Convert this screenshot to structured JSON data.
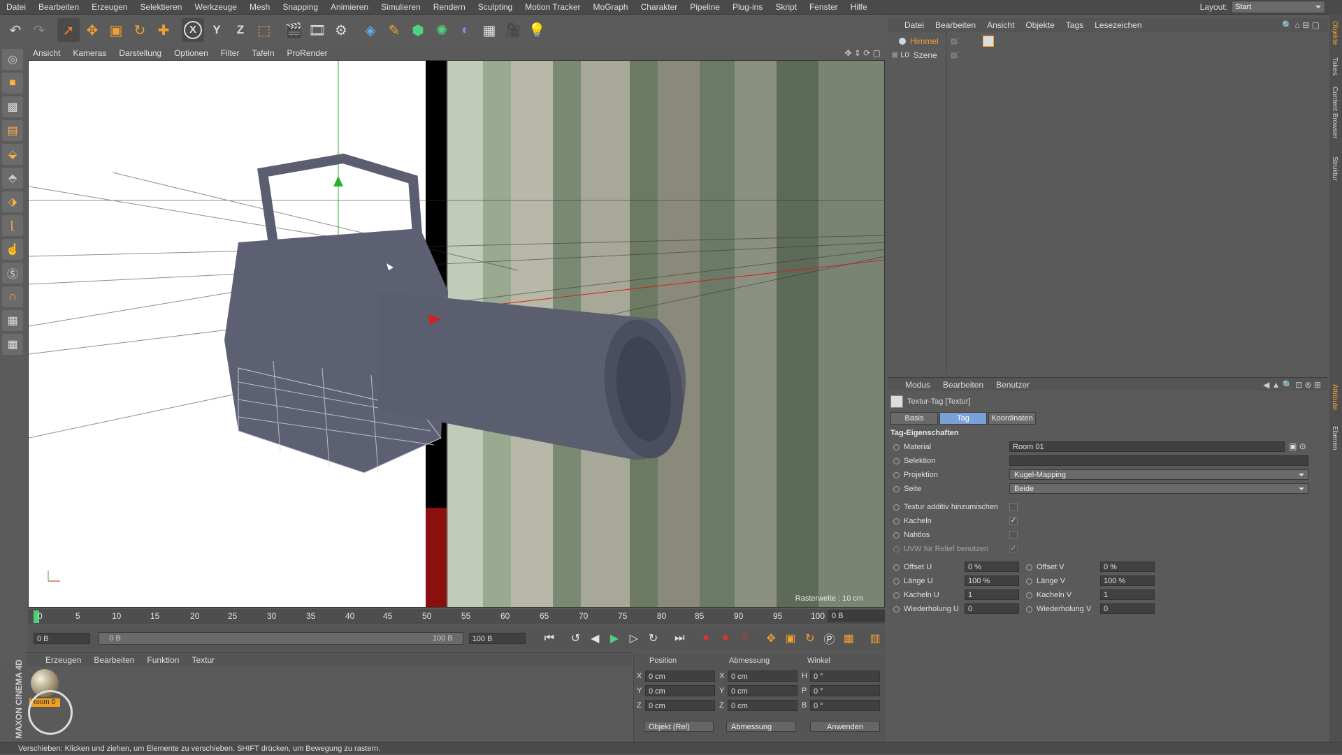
{
  "menubar": {
    "items": [
      "Datei",
      "Bearbeiten",
      "Erzeugen",
      "Selektieren",
      "Werkzeuge",
      "Mesh",
      "Snapping",
      "Animieren",
      "Simulieren",
      "Rendern",
      "Sculpting",
      "Motion Tracker",
      "MoGraph",
      "Charakter",
      "Pipeline",
      "Plug-ins",
      "Skript",
      "Fenster",
      "Hilfe"
    ],
    "layout_label": "Layout:",
    "layout_value": "Start"
  },
  "toolbar": {
    "icons": [
      "undo-icon",
      "select-arrow-icon",
      "move-icon",
      "scale-icon",
      "rotate-icon",
      "add-icon",
      "x-axis-icon",
      "y-axis-icon",
      "z-axis-icon",
      "coord-system-icon",
      "render-view-icon",
      "render-picture-icon",
      "render-settings-icon",
      "cube-icon",
      "pen-icon",
      "subdivision-icon",
      "array-icon",
      "deformer-icon",
      "floor-icon",
      "camera-icon",
      "light-icon"
    ],
    "axis_x": "X",
    "axis_y": "Y",
    "axis_z": "Z"
  },
  "viewport": {
    "menu": [
      "Ansicht",
      "Kameras",
      "Darstellung",
      "Optionen",
      "Filter",
      "Tafeln",
      "ProRender"
    ],
    "raster_text": "Rasterweite : 10 cm"
  },
  "timeline": {
    "ticks": [
      "0",
      "5",
      "10",
      "15",
      "20",
      "25",
      "30",
      "35",
      "40",
      "45",
      "50",
      "55",
      "60",
      "65",
      "70",
      "75",
      "80",
      "85",
      "90",
      "95",
      "100"
    ],
    "current_frame_field": "0 B",
    "start_field": "0 B",
    "range_start": "0 B",
    "range_end": "100 B",
    "end_field": "100 B"
  },
  "material_manager": {
    "menu": [
      "Erzeugen",
      "Bearbeiten",
      "Funktion",
      "Textur"
    ],
    "material_name": "Room 0"
  },
  "logo": {
    "text": "MAXON CINEMA 4D"
  },
  "coord_manager": {
    "headers": [
      "Position",
      "Abmessung",
      "Winkel"
    ],
    "rows": [
      {
        "a": "X",
        "pos": "0 cm",
        "b": "X",
        "size": "0 cm",
        "c": "H",
        "rot": "0 °"
      },
      {
        "a": "Y",
        "pos": "0 cm",
        "b": "Y",
        "size": "0 cm",
        "c": "P",
        "rot": "0 °"
      },
      {
        "a": "Z",
        "pos": "0 cm",
        "b": "Z",
        "size": "0 cm",
        "c": "B",
        "rot": "0 °"
      }
    ],
    "mode_dropdown": "Objekt (Rel)",
    "size_dropdown": "Abmessung",
    "apply_button": "Anwenden"
  },
  "statusbar": {
    "text": "Verschieben: Klicken und ziehen, um Elemente zu verschieben. SHIFT drücken, um Bewegung zu rastern."
  },
  "object_manager": {
    "menu": [
      "Datei",
      "Bearbeiten",
      "Ansicht",
      "Objekte",
      "Tags",
      "Lesezeichen"
    ],
    "objects": [
      {
        "name": "Himmel",
        "selected": true
      },
      {
        "name": "Szene",
        "selected": false
      }
    ]
  },
  "attributes": {
    "menu": [
      "Modus",
      "Bearbeiten",
      "Benutzer"
    ],
    "title": "Textur-Tag [Textur]",
    "tabs": [
      "Basis",
      "Tag",
      "Koordinaten"
    ],
    "active_tab": "Tag",
    "section": "Tag-Eigenschaften",
    "material_label": "Material",
    "material_value": "Room 01",
    "selektion_label": "Selektion",
    "selektion_value": "",
    "projektion_label": "Projektion",
    "projektion_value": "Kugel-Mapping",
    "seite_label": "Seite",
    "seite_value": "Beide",
    "additiv_label": "Textur additiv hinzumischen",
    "kacheln_label": "Kacheln",
    "nahtlos_label": "Nahtlos",
    "uvw_label": "UVW für Relief benutzen",
    "offset_u_label": "Offset U",
    "offset_u": "0 %",
    "offset_v_label": "Offset V",
    "offset_v": "0 %",
    "laenge_u_label": "Länge U",
    "laenge_u": "100 %",
    "laenge_v_label": "Länge V",
    "laenge_v": "100 %",
    "kacheln_u_label": "Kacheln U",
    "kacheln_u": "1",
    "kacheln_v_label": "Kacheln V",
    "kacheln_v": "1",
    "wiederholung_u_label": "Wiederholung U",
    "wiederholung_u": "0",
    "wiederholung_v_label": "Wiederholung V",
    "wiederholung_v": "0"
  },
  "right_tabs": [
    "Objekte",
    "Takes",
    "Content Browser",
    "Struktur",
    "Attribute",
    "Ebenen"
  ],
  "colors": {
    "accent_orange": "#f0a030",
    "tab_active": "#7aa0d8",
    "frame_marker": "#4cd17a"
  }
}
